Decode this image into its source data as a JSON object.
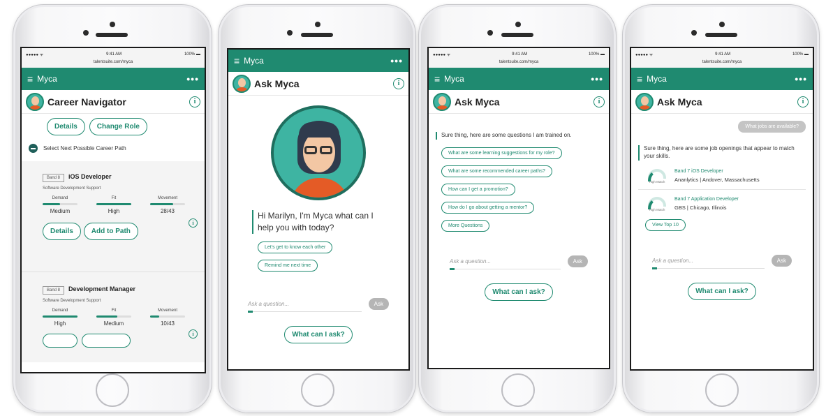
{
  "status": {
    "carrier": "●●●●● ᯤ",
    "time": "9:41 AM",
    "battery": "100% ▬"
  },
  "url": "talentsuite.com/myca",
  "app": {
    "name": "Myca",
    "more": "•••",
    "menu": "≡",
    "info": "i"
  },
  "s1": {
    "title": "Career Navigator",
    "details": "Details",
    "change": "Change Role",
    "next": "Select Next Possible Career Path",
    "jobs": [
      {
        "band": "Band 8",
        "title": "iOS Developer",
        "sub": "Software Development Support",
        "labels": [
          "Demand",
          "Fit",
          "Movement"
        ],
        "vals": [
          "Medium",
          "High",
          "28/43"
        ],
        "fill": [
          0.5,
          1,
          0.65
        ],
        "b1": "Details",
        "b2": "Add to Path"
      },
      {
        "band": "Band 8",
        "title": "Development Manager",
        "sub": "Software Development Support",
        "labels": [
          "Demand",
          "Fit",
          "Movement"
        ],
        "vals": [
          "High",
          "Medium",
          "10/43"
        ],
        "fill": [
          1,
          0.6,
          0.25
        ]
      }
    ]
  },
  "s2": {
    "title": "Ask Myca",
    "greeting": "Hi Marilyn, I'm Myca what can I help you with today?",
    "o1": "Let's get to know each other",
    "o2": "Remind me next time",
    "placeholder": "Ask a question...",
    "ask": "Ask",
    "what": "What can I ask?"
  },
  "s3": {
    "title": "Ask Myca",
    "msg": "Sure thing, here are some questions I am trained on.",
    "q": [
      "What are some learning suggestions for my role?",
      "What are some recommended career paths?",
      "How can I get a promotion?",
      "How do I go about getting a mentor?",
      "More Questions"
    ],
    "placeholder": "Ask a question...",
    "ask": "Ask",
    "what": "What can I ask?"
  },
  "s4": {
    "title": "Ask Myca",
    "user": "What jobs are available?",
    "msg": "Sure thing, here are some job openings that appear to match your skills.",
    "match": "High Match",
    "jobs": [
      {
        "t": "Band 7 iOS Developer",
        "l": "Ananlytics | Andover, Massachusetts"
      },
      {
        "t": "Band 7 Application Developer",
        "l": "GBS | Chicago, Illinois"
      }
    ],
    "view": "View Top 10",
    "placeholder": "Ask a question...",
    "ask": "Ask",
    "what": "What can I ask?"
  },
  "colors": {
    "brand": "#1f8a70"
  }
}
